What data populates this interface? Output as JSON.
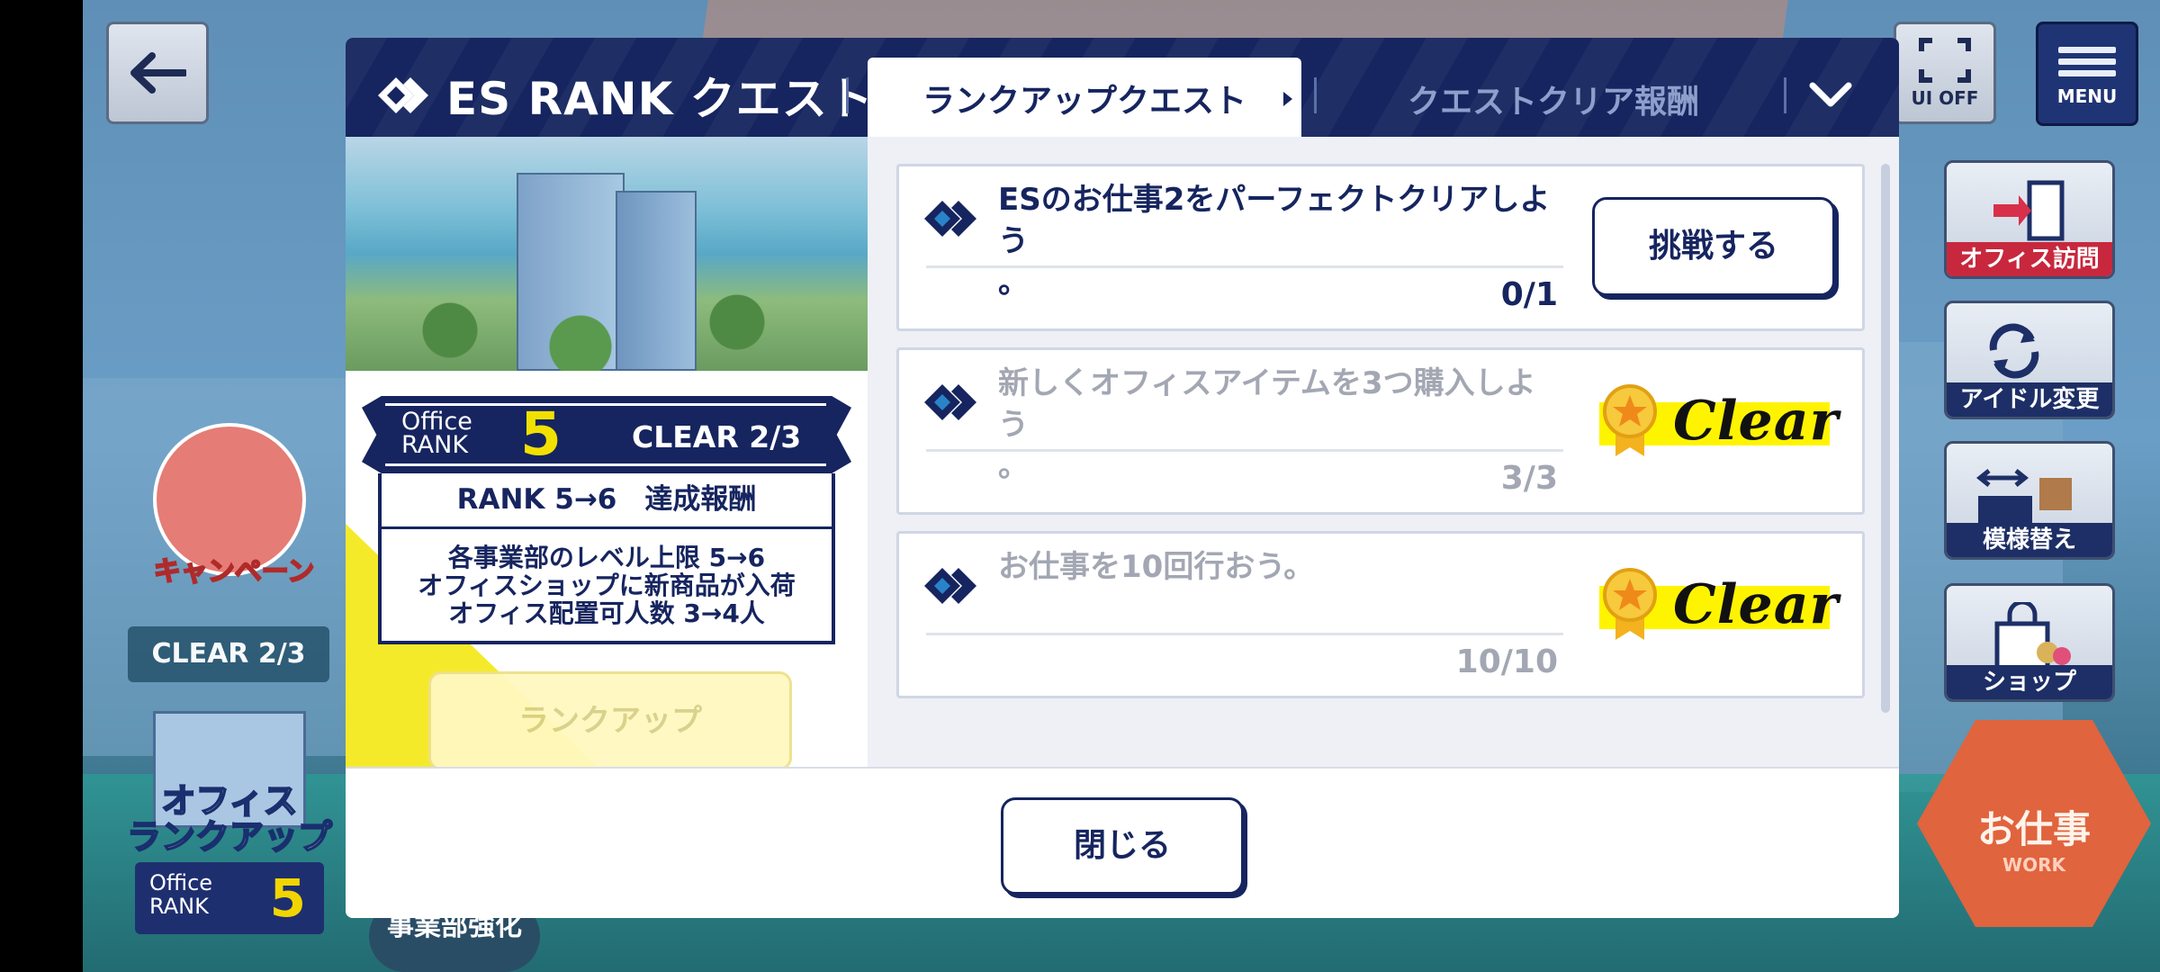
{
  "hud": {
    "ui_off_label": "UI OFF",
    "menu_label": "MENU",
    "side_buttons": [
      {
        "label": "オフィス訪問",
        "icon": "door-icon"
      },
      {
        "label": "アイドル変更",
        "icon": "swap-icon"
      },
      {
        "label": "模様替え",
        "icon": "furniture-icon"
      },
      {
        "label": "ショップ",
        "icon": "shopping-bag-icon"
      }
    ],
    "work": {
      "label": "お仕事",
      "sub": "WORK"
    },
    "campaign_label": "キャンペーン",
    "clear_pill": "CLEAR 2/3",
    "office_rankup": {
      "label_line1": "オフィス",
      "label_line2": "ランクアップ",
      "office": "Office",
      "rank": "RANK",
      "number": "5"
    },
    "bottom_tabs": [
      "事業部強化"
    ]
  },
  "modal": {
    "title": "ES RANK クエスト",
    "tabs": [
      {
        "label": "ランクアップクエスト",
        "active": true
      },
      {
        "label": "クエストクリア報酬",
        "active": false
      }
    ],
    "rank_card": {
      "office": "Office",
      "rank": "RANK",
      "number": "5",
      "clear": "CLEAR  2/3",
      "reward_title": "RANK 5→6　達成報酬",
      "rewards": [
        "各事業部のレベル上限 5→6",
        "オフィスショップに新商品が入荷",
        "オフィス配置可人数 3→4人"
      ]
    },
    "rankup_button": "ランクアップ",
    "quests": [
      {
        "text_line1": "ESのお仕事2をパーフェクトクリアしよう",
        "text_line2": "。",
        "progress": "0/1",
        "status": "open",
        "action": "挑戦する"
      },
      {
        "text_line1": "新しくオフィスアイテムを3つ購入しよう",
        "text_line2": "。",
        "progress": "3/3",
        "status": "clear",
        "action": "Clear"
      },
      {
        "text_line1": "お仕事を10回行おう。",
        "text_line2": "",
        "progress": "10/10",
        "status": "clear",
        "action": "Clear"
      }
    ],
    "close_button": "閉じる"
  },
  "colors": {
    "navy": "#16255f",
    "clear_yellow": "#fff400",
    "work_orange": "#e0643e",
    "accent_yellow": "#f2e100"
  }
}
